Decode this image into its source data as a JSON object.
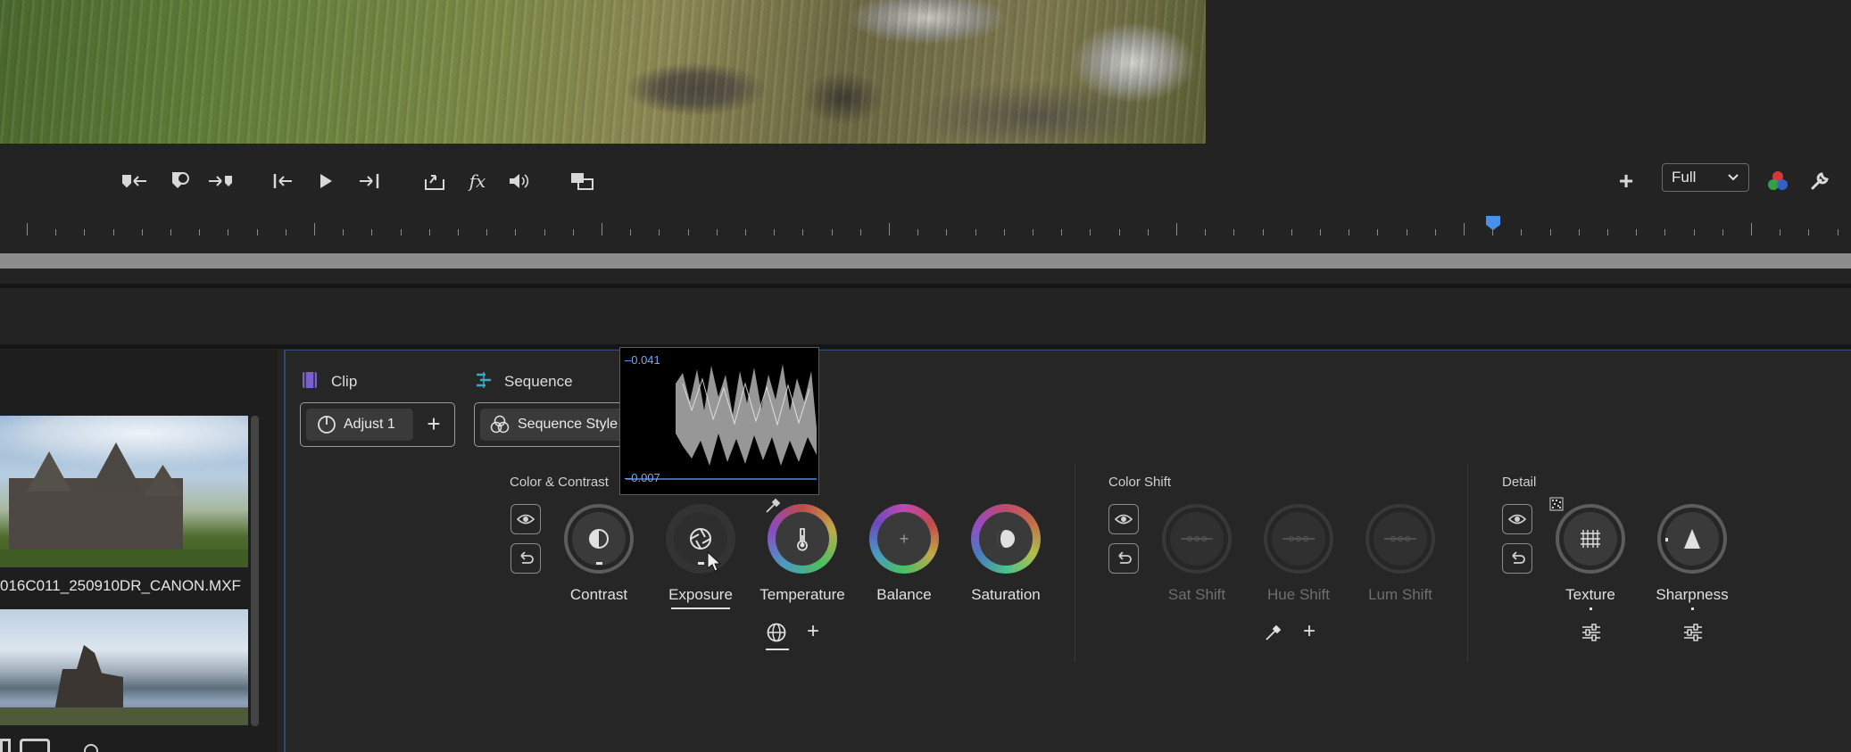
{
  "quality_select": {
    "value": "Full"
  },
  "media": {
    "clip_label": "016C011_250910DR_CANON.MXF"
  },
  "panel": {
    "clip_tab": "Clip",
    "sequence_tab": "Sequence",
    "adjust_chip": "Adjust 1",
    "sequence_chip": "Sequence Style"
  },
  "scope": {
    "top_value": "0.041",
    "bottom_value": "0.007"
  },
  "sections": {
    "color_contrast": {
      "title": "Color & Contrast",
      "dials": [
        "Contrast",
        "Exposure",
        "Temperature",
        "Balance",
        "Saturation"
      ]
    },
    "color_shift": {
      "title": "Color Shift",
      "dials": [
        "Sat Shift",
        "Hue Shift",
        "Lum Shift"
      ]
    },
    "detail": {
      "title": "Detail",
      "dials": [
        "Texture",
        "Sharpness"
      ]
    }
  },
  "colors": {
    "accent": "#4a8fe8",
    "scope_text": "#7aa6e8"
  }
}
